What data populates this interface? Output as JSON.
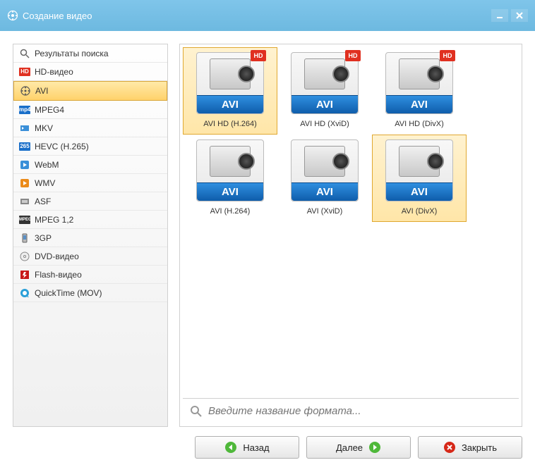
{
  "window": {
    "title": "Создание видео"
  },
  "sidebar": {
    "items": [
      {
        "label": "Результаты поиска",
        "icon": "search-icon"
      },
      {
        "label": "HD-видео",
        "icon": "hd-icon"
      },
      {
        "label": "AVI",
        "icon": "film-reel-icon",
        "selected": true
      },
      {
        "label": "MPEG4",
        "icon": "mp4-icon"
      },
      {
        "label": "MKV",
        "icon": "mkv-icon"
      },
      {
        "label": "HEVC (H.265)",
        "icon": "265-icon"
      },
      {
        "label": "WebM",
        "icon": "play-icon"
      },
      {
        "label": "WMV",
        "icon": "play-orange-icon"
      },
      {
        "label": "ASF",
        "icon": "asf-icon"
      },
      {
        "label": "MPEG 1,2",
        "icon": "mpeg-icon"
      },
      {
        "label": "3GP",
        "icon": "phone-icon"
      },
      {
        "label": "DVD-видео",
        "icon": "disc-icon"
      },
      {
        "label": "Flash-видео",
        "icon": "flash-icon"
      },
      {
        "label": "QuickTime (MOV)",
        "icon": "quicktime-icon"
      }
    ]
  },
  "grid": {
    "format_badge": "AVI",
    "hd_badge": "HD",
    "items": [
      {
        "caption": "AVI HD (H.264)",
        "hd": true,
        "selected": true
      },
      {
        "caption": "AVI HD (XviD)",
        "hd": true
      },
      {
        "caption": "AVI HD (DivX)",
        "hd": true
      },
      {
        "caption": "AVI (H.264)",
        "hd": false
      },
      {
        "caption": "AVI (XviD)",
        "hd": false
      },
      {
        "caption": "AVI (DivX)",
        "hd": false,
        "selected": true
      }
    ]
  },
  "search": {
    "placeholder": "Введите название формата..."
  },
  "footer": {
    "back": "Назад",
    "next": "Далее",
    "close": "Закрыть"
  }
}
